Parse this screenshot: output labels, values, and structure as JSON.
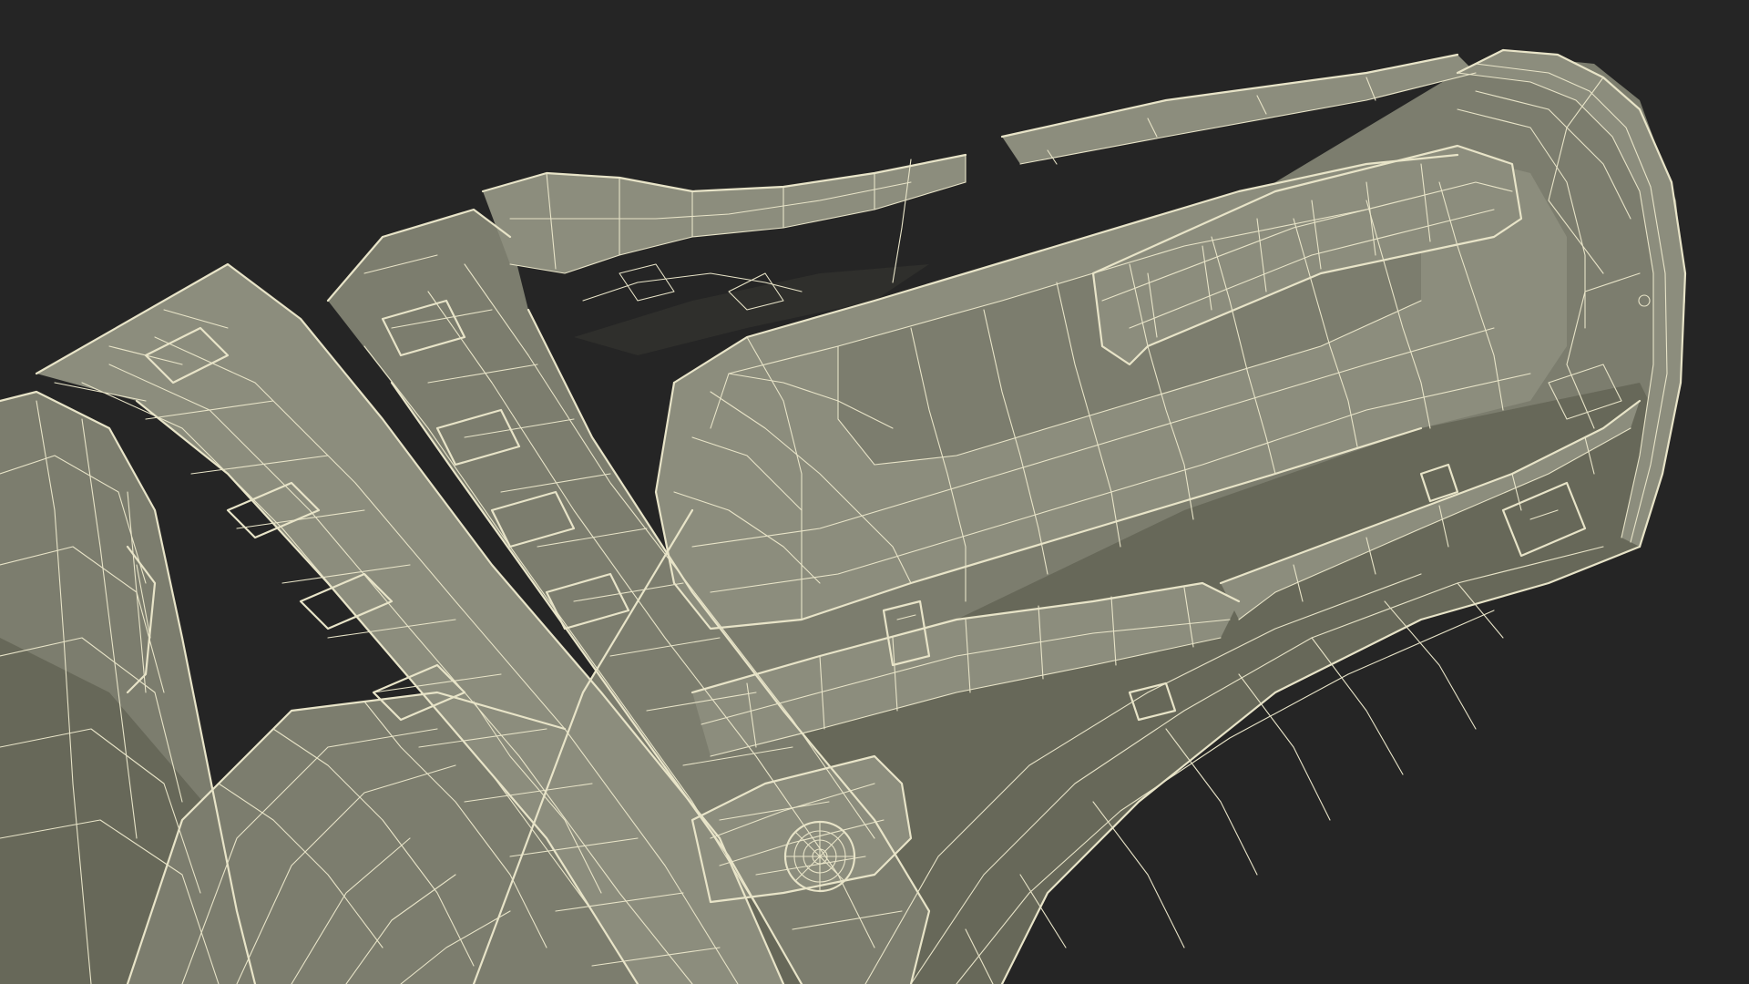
{
  "viewport": {
    "background_color": "#252525",
    "model_fill_color": "#7c7d6e",
    "model_shadow_color": "#676859",
    "wireframe_color": "#e8e4c8",
    "render_mode": "wireframe-over-shaded"
  }
}
